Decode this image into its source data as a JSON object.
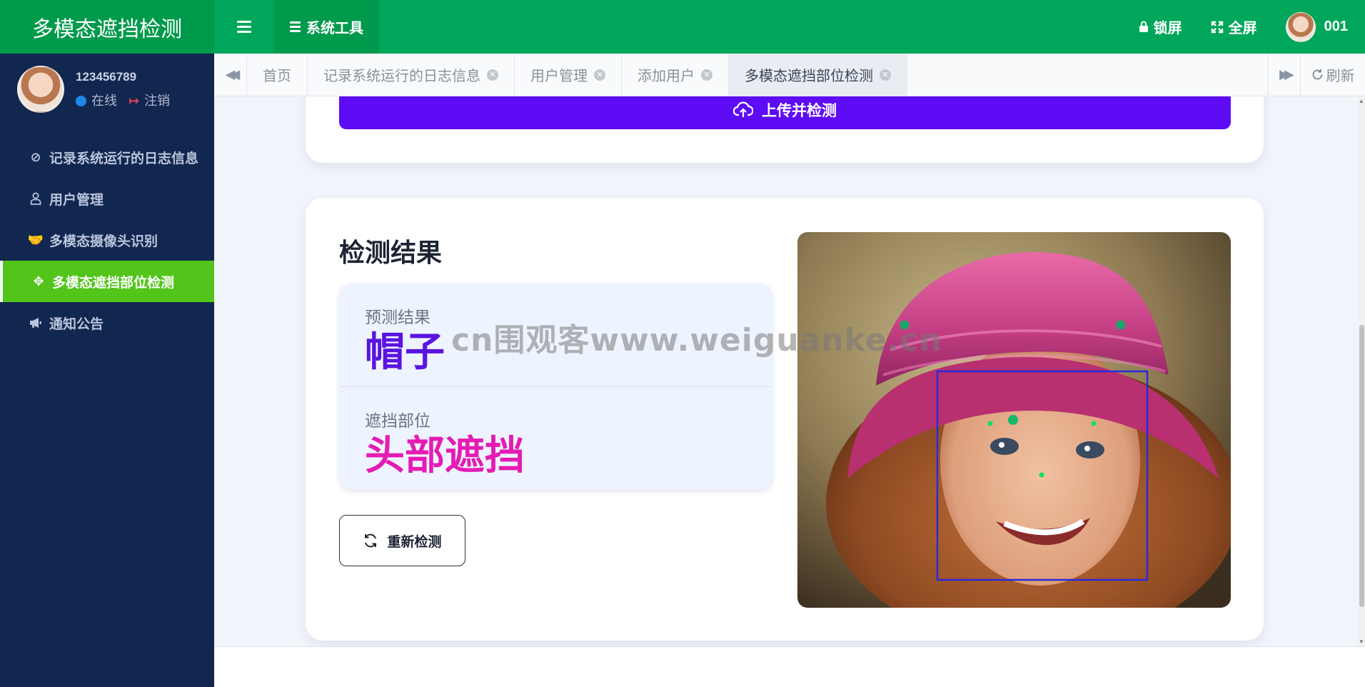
{
  "header": {
    "app_title": "多模态遮挡检测",
    "tab_label": "系统工具",
    "lock_label": "锁屏",
    "fullscreen_label": "全屏",
    "user_name": "001",
    "accent_color": "#00a65a"
  },
  "sidebar": {
    "user": {
      "id": "123456789",
      "status": "在线",
      "logout": "注销"
    },
    "items": [
      {
        "label": "记录系统运行的日志信息",
        "icon": "ban-icon"
      },
      {
        "label": "用户管理",
        "icon": "user-icon"
      },
      {
        "label": "多模态摄像头识别",
        "icon": "handshake-icon"
      },
      {
        "label": "多模态遮挡部位检测",
        "icon": "move-arrows-icon",
        "active": true
      },
      {
        "label": "通知公告",
        "icon": "bullhorn-icon"
      }
    ],
    "background_color": "#12274f",
    "active_color": "#52c41a"
  },
  "tabs": {
    "items": [
      {
        "label": "首页"
      },
      {
        "label": "记录系统运行的日志信息"
      },
      {
        "label": "用户管理"
      },
      {
        "label": "添加用户"
      },
      {
        "label": "多模态遮挡部位检测",
        "active": true
      }
    ],
    "refresh_label": "刷新"
  },
  "upload": {
    "button_label": "上传并检测",
    "button_color": "#5e0cf5"
  },
  "result": {
    "title": "检测结果",
    "prediction_label": "预测结果",
    "prediction_value": "帽子",
    "region_label": "遮挡部位",
    "region_value": "头部遮挡",
    "redetect_label": "重新检测"
  },
  "watermark": "cn围观客www.weiguanke.cn"
}
